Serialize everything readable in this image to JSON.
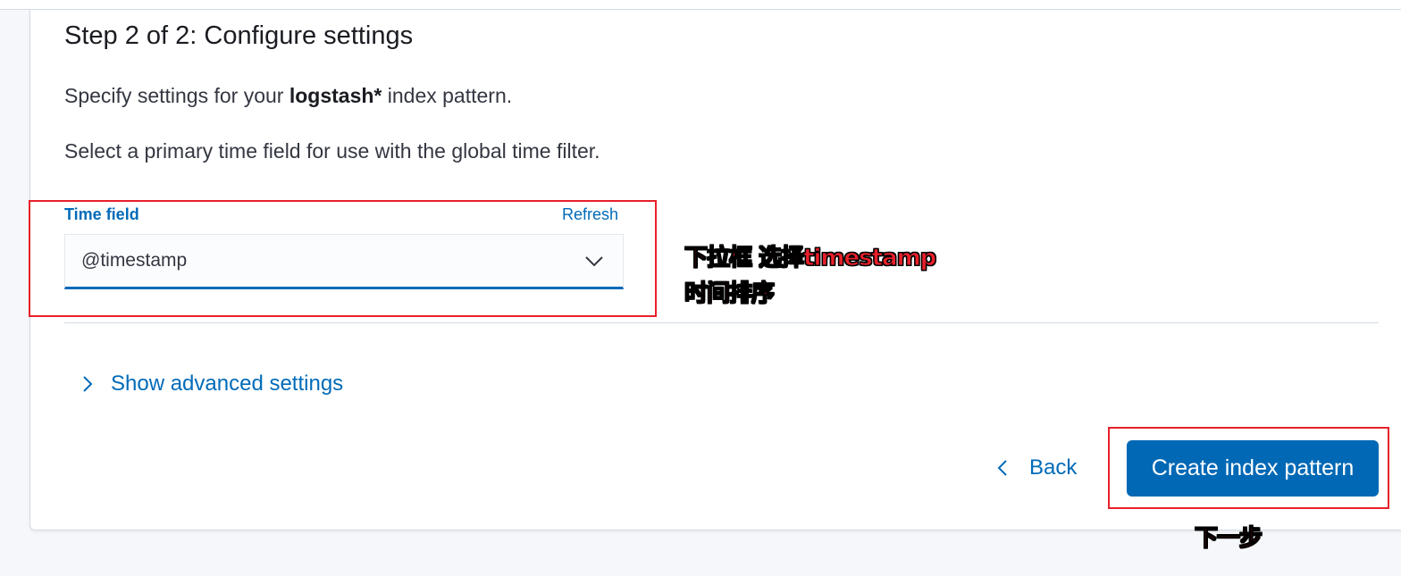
{
  "step": {
    "title": "Step 2 of 2: Configure settings",
    "description_prefix": "Specify settings for your ",
    "index_pattern": "logstash*",
    "description_suffix": " index pattern.",
    "time_filter_hint": "Select a primary time field for use with the global time filter."
  },
  "time_field": {
    "label": "Time field",
    "refresh_label": "Refresh",
    "selected_value": "@timestamp"
  },
  "advanced": {
    "toggle_label": "Show advanced settings"
  },
  "actions": {
    "back_label": "Back",
    "create_label": "Create index pattern"
  },
  "annotations": {
    "dropdown_note_line1": "下拉框 选择timestamp",
    "dropdown_note_line2": "时间排序",
    "button_note": "下一步"
  },
  "colors": {
    "accent": "#006bb8",
    "primary_button": "#0068b5",
    "annotation_red": "#e8202a"
  }
}
